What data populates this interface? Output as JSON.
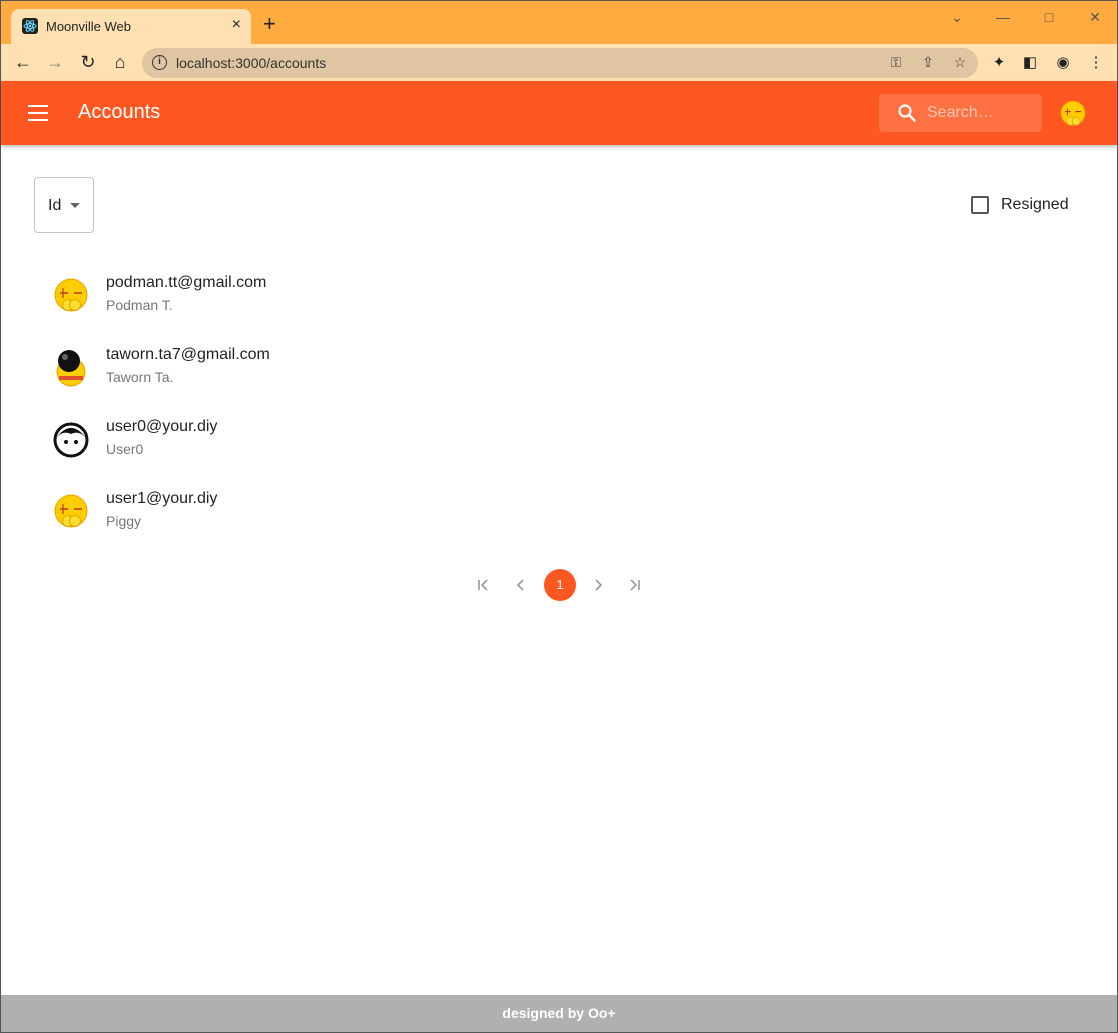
{
  "browser": {
    "tab_title": "Moonville Web",
    "tab_close": "×",
    "new_tab": "+",
    "url": "localhost:3000/accounts",
    "window_controls": {
      "collapse": "⌄",
      "minimize": "—",
      "maximize": "□",
      "close": "✕"
    }
  },
  "appbar": {
    "title": "Accounts",
    "search_placeholder": "Search…"
  },
  "filters": {
    "sort_value": "Id",
    "resigned_label": "Resigned",
    "resigned_checked": false
  },
  "accounts": [
    {
      "email": "podman.tt@gmail.com",
      "name": "Podman T.",
      "avatar": "yellow-face-icon"
    },
    {
      "email": "taworn.ta7@gmail.com",
      "name": "Taworn Ta.",
      "avatar": "bomb-face-icon"
    },
    {
      "email": "user0@your.diy",
      "name": "User0",
      "avatar": "default-face-icon"
    },
    {
      "email": "user1@your.diy",
      "name": "Piggy",
      "avatar": "yellow-face-icon"
    }
  ],
  "pagination": {
    "current_page": "1",
    "first_icon": "first-page-icon",
    "prev_icon": "chevron-left-icon",
    "next_icon": "chevron-right-icon",
    "last_icon": "last-page-icon"
  },
  "footer": {
    "text": "designed by Oo+"
  },
  "colors": {
    "primary": "#ff5722",
    "titlebar": "#ffab40",
    "toolbar": "#ffe0b2",
    "footer": "#b0b0b0"
  }
}
